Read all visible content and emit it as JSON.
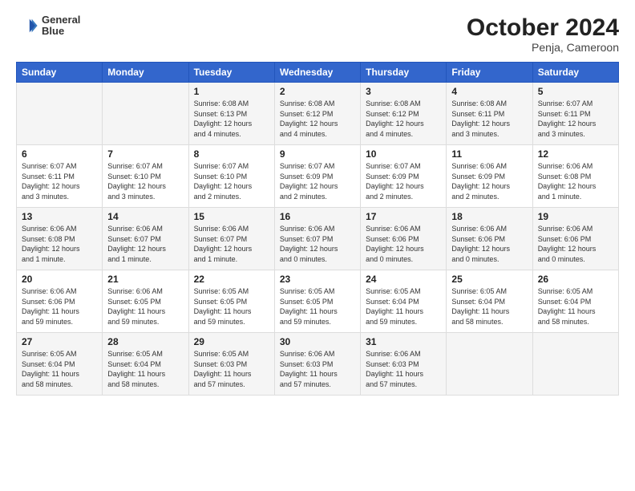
{
  "header": {
    "logo_line1": "General",
    "logo_line2": "Blue",
    "title": "October 2024",
    "subtitle": "Penja, Cameroon"
  },
  "days_of_week": [
    "Sunday",
    "Monday",
    "Tuesday",
    "Wednesday",
    "Thursday",
    "Friday",
    "Saturday"
  ],
  "weeks": [
    [
      {
        "day": "",
        "info": ""
      },
      {
        "day": "",
        "info": ""
      },
      {
        "day": "1",
        "info": "Sunrise: 6:08 AM\nSunset: 6:13 PM\nDaylight: 12 hours\nand 4 minutes."
      },
      {
        "day": "2",
        "info": "Sunrise: 6:08 AM\nSunset: 6:12 PM\nDaylight: 12 hours\nand 4 minutes."
      },
      {
        "day": "3",
        "info": "Sunrise: 6:08 AM\nSunset: 6:12 PM\nDaylight: 12 hours\nand 4 minutes."
      },
      {
        "day": "4",
        "info": "Sunrise: 6:08 AM\nSunset: 6:11 PM\nDaylight: 12 hours\nand 3 minutes."
      },
      {
        "day": "5",
        "info": "Sunrise: 6:07 AM\nSunset: 6:11 PM\nDaylight: 12 hours\nand 3 minutes."
      }
    ],
    [
      {
        "day": "6",
        "info": "Sunrise: 6:07 AM\nSunset: 6:11 PM\nDaylight: 12 hours\nand 3 minutes."
      },
      {
        "day": "7",
        "info": "Sunrise: 6:07 AM\nSunset: 6:10 PM\nDaylight: 12 hours\nand 3 minutes."
      },
      {
        "day": "8",
        "info": "Sunrise: 6:07 AM\nSunset: 6:10 PM\nDaylight: 12 hours\nand 2 minutes."
      },
      {
        "day": "9",
        "info": "Sunrise: 6:07 AM\nSunset: 6:09 PM\nDaylight: 12 hours\nand 2 minutes."
      },
      {
        "day": "10",
        "info": "Sunrise: 6:07 AM\nSunset: 6:09 PM\nDaylight: 12 hours\nand 2 minutes."
      },
      {
        "day": "11",
        "info": "Sunrise: 6:06 AM\nSunset: 6:09 PM\nDaylight: 12 hours\nand 2 minutes."
      },
      {
        "day": "12",
        "info": "Sunrise: 6:06 AM\nSunset: 6:08 PM\nDaylight: 12 hours\nand 1 minute."
      }
    ],
    [
      {
        "day": "13",
        "info": "Sunrise: 6:06 AM\nSunset: 6:08 PM\nDaylight: 12 hours\nand 1 minute."
      },
      {
        "day": "14",
        "info": "Sunrise: 6:06 AM\nSunset: 6:07 PM\nDaylight: 12 hours\nand 1 minute."
      },
      {
        "day": "15",
        "info": "Sunrise: 6:06 AM\nSunset: 6:07 PM\nDaylight: 12 hours\nand 1 minute."
      },
      {
        "day": "16",
        "info": "Sunrise: 6:06 AM\nSunset: 6:07 PM\nDaylight: 12 hours\nand 0 minutes."
      },
      {
        "day": "17",
        "info": "Sunrise: 6:06 AM\nSunset: 6:06 PM\nDaylight: 12 hours\nand 0 minutes."
      },
      {
        "day": "18",
        "info": "Sunrise: 6:06 AM\nSunset: 6:06 PM\nDaylight: 12 hours\nand 0 minutes."
      },
      {
        "day": "19",
        "info": "Sunrise: 6:06 AM\nSunset: 6:06 PM\nDaylight: 12 hours\nand 0 minutes."
      }
    ],
    [
      {
        "day": "20",
        "info": "Sunrise: 6:06 AM\nSunset: 6:06 PM\nDaylight: 11 hours\nand 59 minutes."
      },
      {
        "day": "21",
        "info": "Sunrise: 6:06 AM\nSunset: 6:05 PM\nDaylight: 11 hours\nand 59 minutes."
      },
      {
        "day": "22",
        "info": "Sunrise: 6:05 AM\nSunset: 6:05 PM\nDaylight: 11 hours\nand 59 minutes."
      },
      {
        "day": "23",
        "info": "Sunrise: 6:05 AM\nSunset: 6:05 PM\nDaylight: 11 hours\nand 59 minutes."
      },
      {
        "day": "24",
        "info": "Sunrise: 6:05 AM\nSunset: 6:04 PM\nDaylight: 11 hours\nand 59 minutes."
      },
      {
        "day": "25",
        "info": "Sunrise: 6:05 AM\nSunset: 6:04 PM\nDaylight: 11 hours\nand 58 minutes."
      },
      {
        "day": "26",
        "info": "Sunrise: 6:05 AM\nSunset: 6:04 PM\nDaylight: 11 hours\nand 58 minutes."
      }
    ],
    [
      {
        "day": "27",
        "info": "Sunrise: 6:05 AM\nSunset: 6:04 PM\nDaylight: 11 hours\nand 58 minutes."
      },
      {
        "day": "28",
        "info": "Sunrise: 6:05 AM\nSunset: 6:04 PM\nDaylight: 11 hours\nand 58 minutes."
      },
      {
        "day": "29",
        "info": "Sunrise: 6:05 AM\nSunset: 6:03 PM\nDaylight: 11 hours\nand 57 minutes."
      },
      {
        "day": "30",
        "info": "Sunrise: 6:06 AM\nSunset: 6:03 PM\nDaylight: 11 hours\nand 57 minutes."
      },
      {
        "day": "31",
        "info": "Sunrise: 6:06 AM\nSunset: 6:03 PM\nDaylight: 11 hours\nand 57 minutes."
      },
      {
        "day": "",
        "info": ""
      },
      {
        "day": "",
        "info": ""
      }
    ]
  ]
}
